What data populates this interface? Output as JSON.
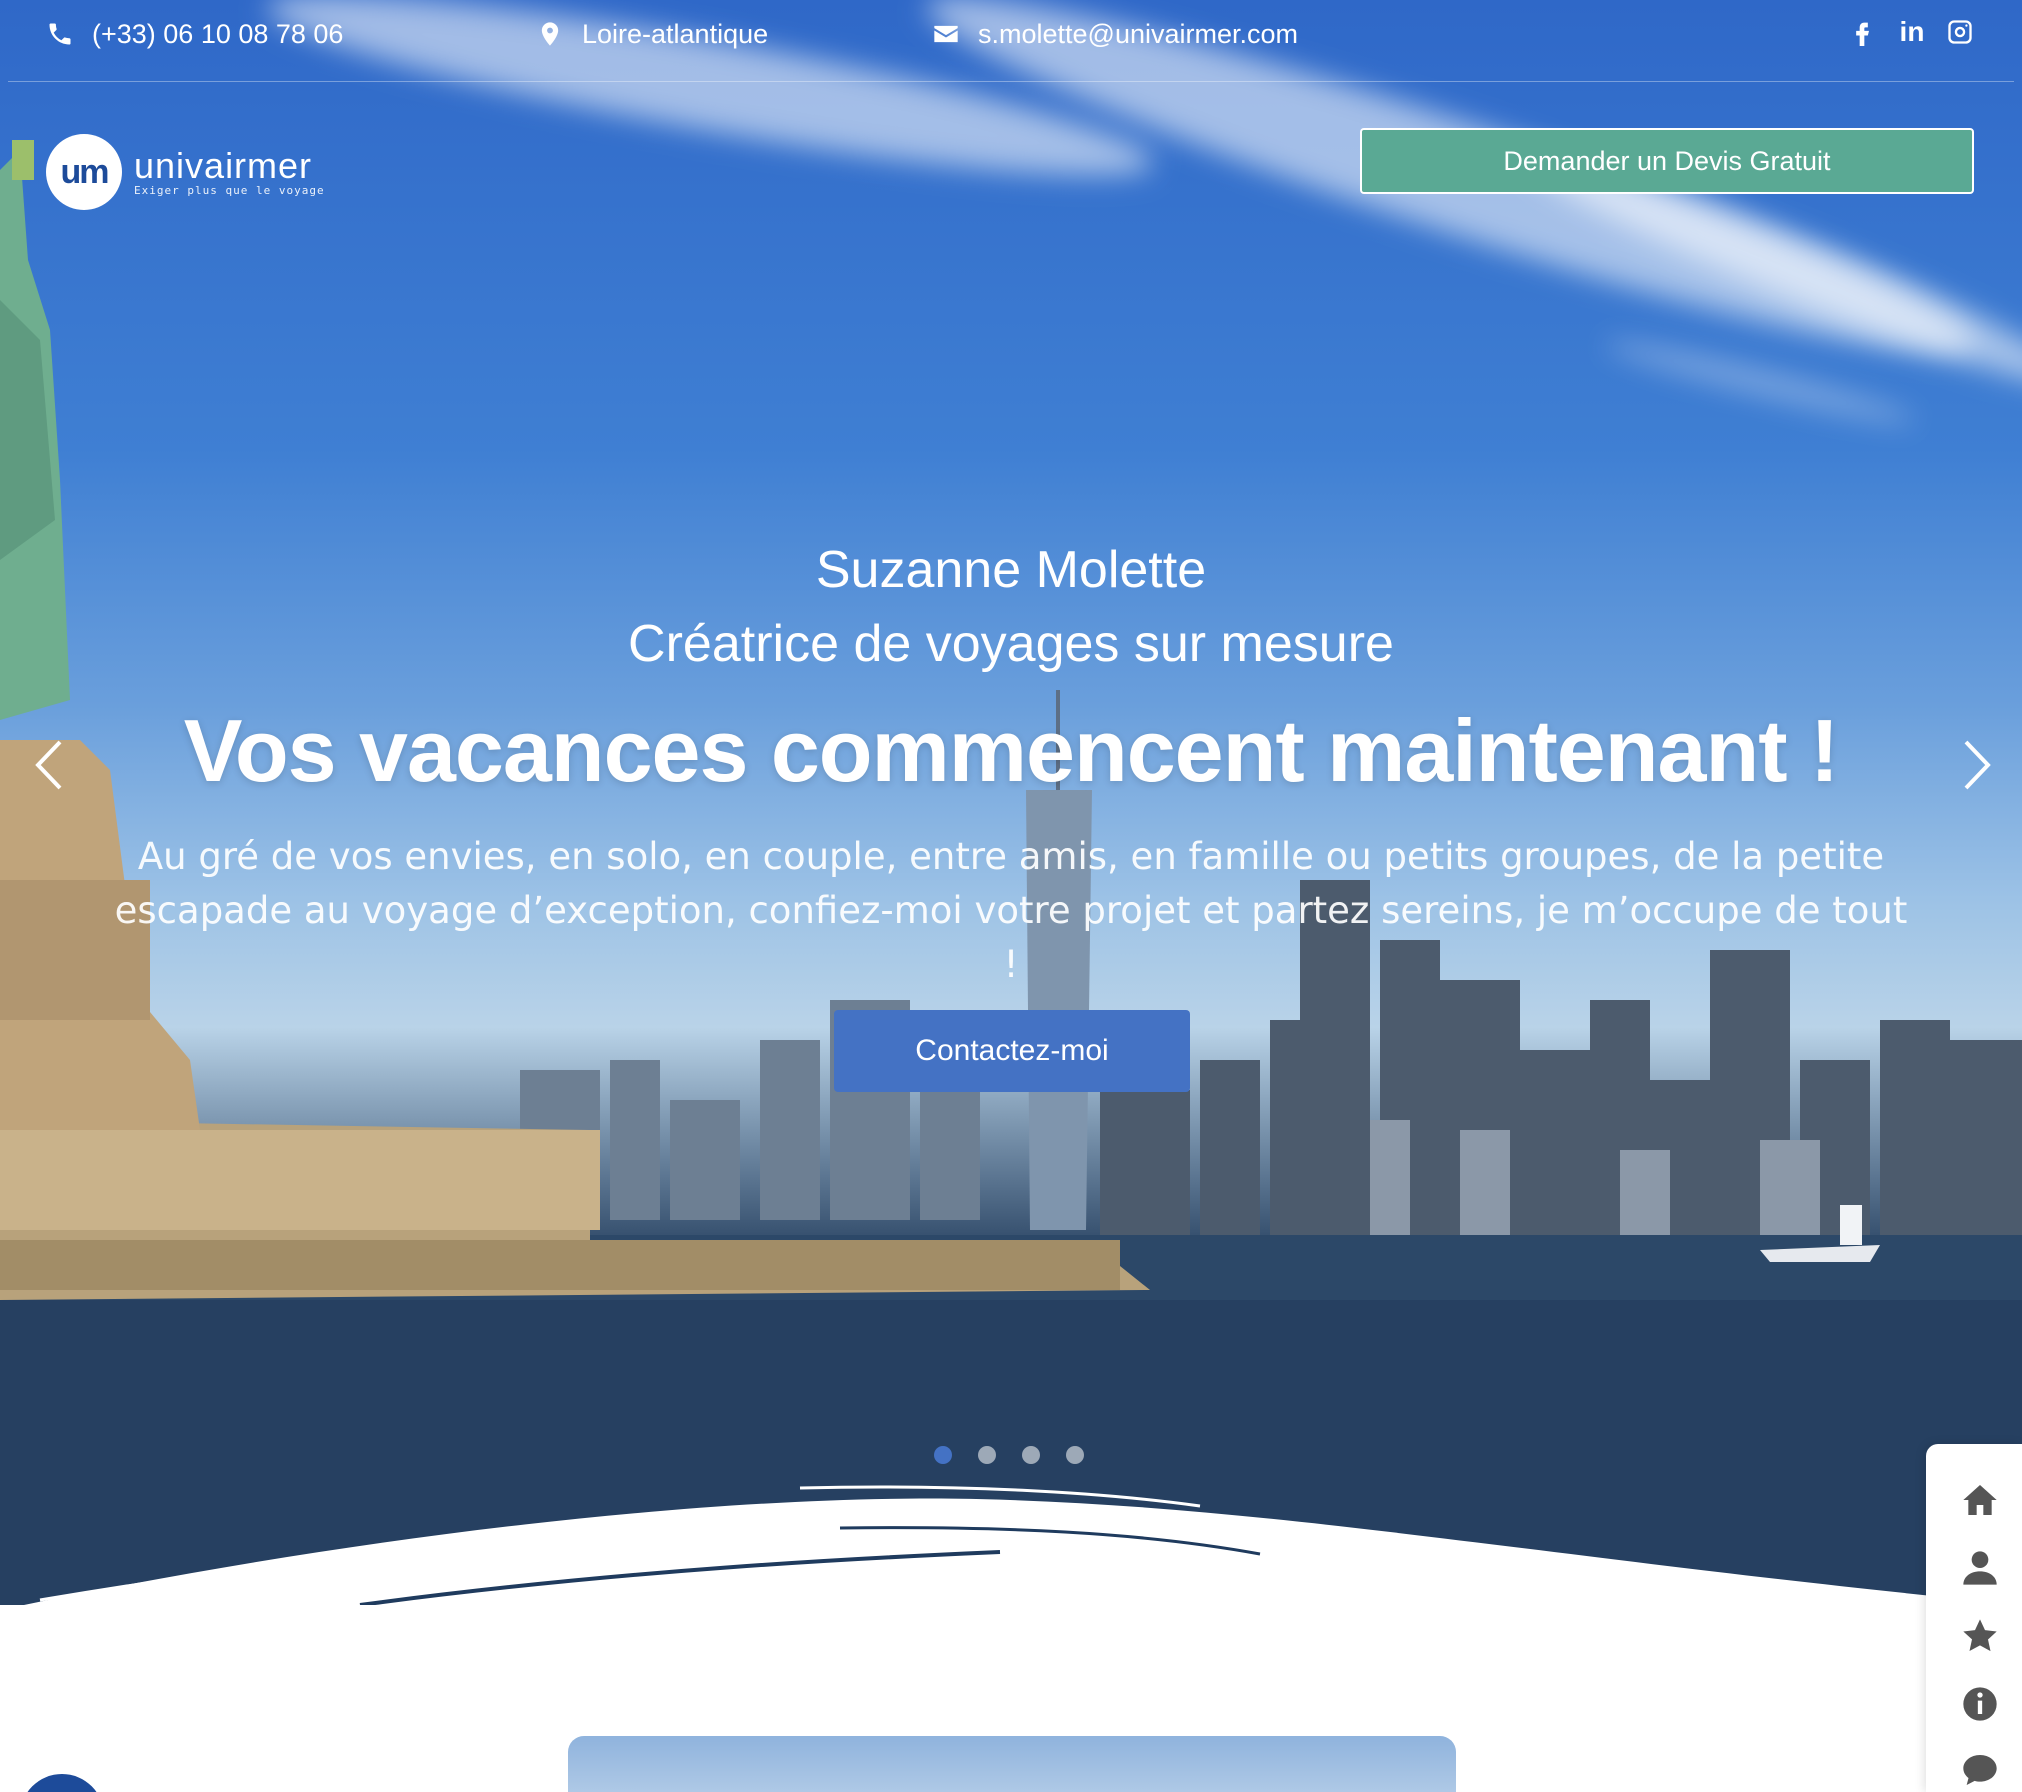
{
  "topbar": {
    "phone": "(+33) 06 10 08 78 06",
    "location": "Loire-atlantique",
    "email": "s.molette@univairmer.com",
    "social": [
      "facebook-icon",
      "linkedin-icon",
      "instagram-icon"
    ],
    "linkedin_label": "in"
  },
  "logo": {
    "mark": "um",
    "name": "univairmer",
    "tagline": "Exiger plus que le voyage"
  },
  "header": {
    "devis_button": "Demander un Devis Gratuit"
  },
  "hero": {
    "name": "Suzanne Molette",
    "role": "Créatrice de voyages sur mesure",
    "title": "Vos vacances commencent maintenant !",
    "description": "Au gré de vos envies, en solo, en couple, entre amis, en famille ou petits groupes, de la petite escapade au voyage d’exception, confiez-moi votre projet et partez sereins, je m’occupe de tout !",
    "cta": "Contactez-moi",
    "slide_count": 4,
    "active_slide": 1
  },
  "side_menu": {
    "items": [
      "home-icon",
      "user-icon",
      "star-icon",
      "info-icon",
      "comment-icon"
    ]
  },
  "colors": {
    "green_button": "#5aa994",
    "blue_accent": "#4472c4",
    "brand_blue": "#1d4b9a"
  }
}
